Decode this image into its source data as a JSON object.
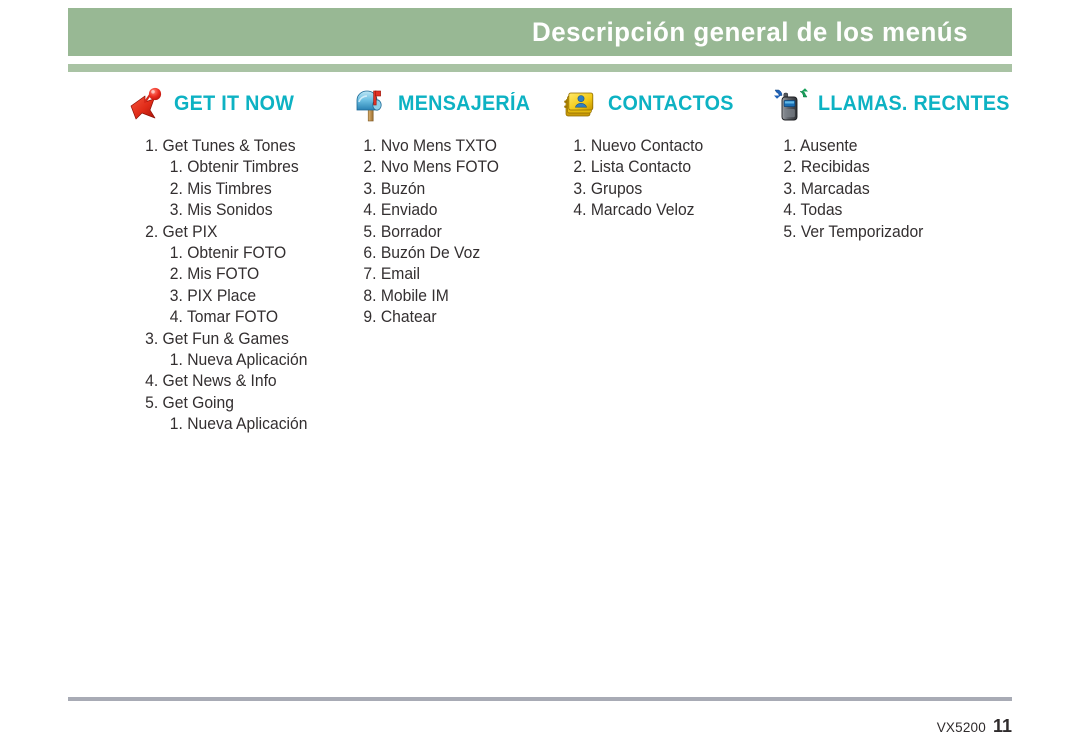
{
  "header": {
    "title": "Descripción general de los menús",
    "band_color": "#98b894",
    "rule_color": "#a9c3a4",
    "title_color": "#ffffff"
  },
  "theme": {
    "heading_color": "#0db2c3",
    "body_text_color": "#332f30",
    "footer_rule_color": "#a8abb5"
  },
  "columns": [
    {
      "id": "get-it-now",
      "label": "GET IT NOW",
      "icon": "red-arrow-ball-icon",
      "items": [
        {
          "text": "1. Get Tunes & Tones",
          "level": 1
        },
        {
          "text": "1. Obtenir Timbres",
          "level": 2
        },
        {
          "text": "2. Mis Timbres",
          "level": 2
        },
        {
          "text": "3. Mis Sonidos",
          "level": 2
        },
        {
          "text": "2. Get PIX",
          "level": 1
        },
        {
          "text": "1. Obtenir FOTO",
          "level": 2
        },
        {
          "text": "2. Mis FOTO",
          "level": 2
        },
        {
          "text": "3. PIX Place",
          "level": 2
        },
        {
          "text": "4. Tomar FOTO",
          "level": 2
        },
        {
          "text": "3. Get Fun & Games",
          "level": 1
        },
        {
          "text": "1. Nueva Aplicación",
          "level": 2
        },
        {
          "text": "4. Get News & Info",
          "level": 1
        },
        {
          "text": "5. Get Going",
          "level": 1
        },
        {
          "text": "1. Nueva Aplicación",
          "level": 2
        }
      ]
    },
    {
      "id": "mensajeria",
      "label": "MENSAJERÍA",
      "icon": "mailbox-icon",
      "items": [
        {
          "text": "1. Nvo Mens TXTO",
          "level": 0
        },
        {
          "text": "2. Nvo Mens FOTO",
          "level": 0
        },
        {
          "text": "3. Buzón",
          "level": 0
        },
        {
          "text": "4. Enviado",
          "level": 0
        },
        {
          "text": "5. Borrador",
          "level": 0
        },
        {
          "text": "6. Buzón De Voz",
          "level": 0
        },
        {
          "text": "7. Email",
          "level": 0
        },
        {
          "text": "8. Mobile IM",
          "level": 0
        },
        {
          "text": "9. Chatear",
          "level": 0
        }
      ]
    },
    {
      "id": "contactos",
      "label": "CONTACTOS",
      "icon": "address-book-icon",
      "items": [
        {
          "text": "1. Nuevo Contacto",
          "level": 0
        },
        {
          "text": "2. Lista Contacto",
          "level": 0
        },
        {
          "text": "3. Grupos",
          "level": 0
        },
        {
          "text": "4. Marcado Veloz",
          "level": 0
        }
      ]
    },
    {
      "id": "llamas-recntes",
      "label": "LLAMAS. RECNTES",
      "icon": "mobile-phone-calls-icon",
      "items": [
        {
          "text": "1. Ausente",
          "level": 0
        },
        {
          "text": "2. Recibidas",
          "level": 0
        },
        {
          "text": "3. Marcadas",
          "level": 0
        },
        {
          "text": "4. Todas",
          "level": 0
        },
        {
          "text": "5. Ver Temporizador",
          "level": 0
        }
      ]
    }
  ],
  "footer": {
    "model": "VX5200",
    "page_number": "11"
  }
}
